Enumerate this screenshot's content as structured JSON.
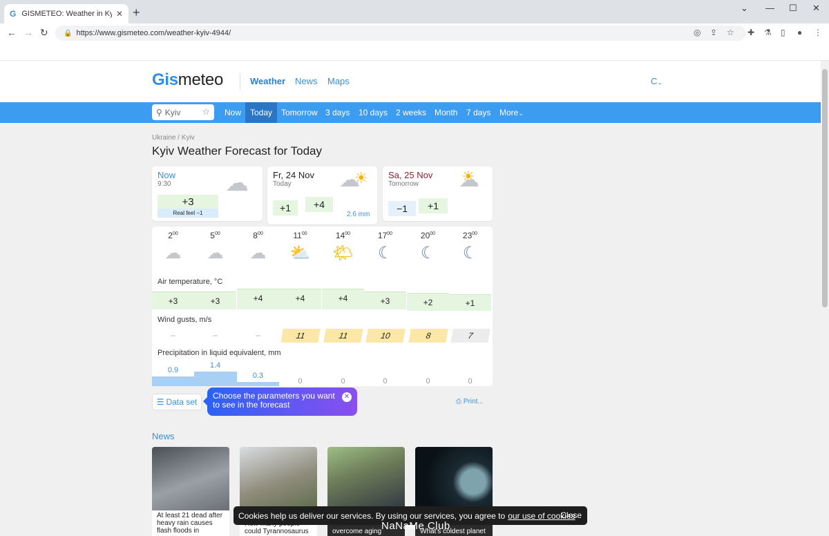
{
  "browser": {
    "tab_title": "GISMETEO: Weather in Kyiv toda",
    "tab_favicon": "G",
    "url": "https://www.gismeteo.com/weather-kyiv-4944/"
  },
  "header": {
    "logo_a": "Gis",
    "logo_b": "meteo",
    "nav": [
      "Weather",
      "News",
      "Maps"
    ],
    "unit": "C"
  },
  "search": {
    "value": "Kyiv"
  },
  "bluenav": [
    "Now",
    "Today",
    "Tomorrow",
    "3 days",
    "10 days",
    "2 weeks",
    "Month",
    "7 days",
    "More"
  ],
  "breadcrumb": "Ukraine / Kyiv",
  "title": "Kyiv Weather Forecast for Today",
  "cards": {
    "now": {
      "title": "Now",
      "time": "9:30",
      "temp": "+3",
      "feel": "Real feel −1"
    },
    "today": {
      "title": "Fr, 24 Nov",
      "sub": "Today",
      "min": "+1",
      "max": "+4",
      "precip": "2.6 mm"
    },
    "tomorrow": {
      "title": "Sa, 25 Nov",
      "sub": "Tomorrow",
      "min": "−1",
      "max": "+1"
    }
  },
  "hourly": {
    "hours": [
      {
        "h": "2",
        "m": "00"
      },
      {
        "h": "5",
        "m": "00"
      },
      {
        "h": "8",
        "m": "00"
      },
      {
        "h": "11",
        "m": "00"
      },
      {
        "h": "14",
        "m": "00"
      },
      {
        "h": "17",
        "m": "00"
      },
      {
        "h": "20",
        "m": "00"
      },
      {
        "h": "23",
        "m": "00"
      }
    ],
    "icons": [
      "cloud-rain-icon",
      "cloud-rain-icon",
      "cloud-rain-icon",
      "partly-sunny-icon",
      "sun-cloud-icon",
      "moon-stars-icon",
      "moon-stars-icon",
      "moon-stars-icon"
    ],
    "temp_label": "Air temperature, °C",
    "temps": [
      "+3",
      "+3",
      "+4",
      "+4",
      "+4",
      "+3",
      "+2",
      "+1"
    ],
    "wind_label": "Wind gusts, m/s",
    "wind": [
      "–",
      "–",
      "–",
      "11",
      "11",
      "10",
      "8",
      "7"
    ],
    "precip_label": "Precipitation in liquid equivalent, mm",
    "precip": [
      "0.9",
      "1.4",
      "0.3",
      "0",
      "0",
      "0",
      "0",
      "0"
    ]
  },
  "dataset_label": "Data set",
  "tooltip": "Choose the parameters you want to see in the forecast",
  "print_label": "Print...",
  "news_heading": "News",
  "news": [
    {
      "caption": "At least 21 dead after heavy rain causes flash floods in"
    },
    {
      "caption": "How many people could Tyrannosaurus"
    },
    {
      "caption": "overcome aging"
    },
    {
      "caption": "What's coldest planet"
    }
  ],
  "cookie": {
    "text": "Cookies help us deliver our services. By using our services, you agree to",
    "link": "our use of cookies",
    "close": "Close"
  },
  "watermark": "NaNaMe Club",
  "colors": {
    "accent": "#3c9cf0",
    "active": "#2c74c4",
    "temp_bg": "#e5f5df",
    "precip_bar": "#a8cff4"
  }
}
